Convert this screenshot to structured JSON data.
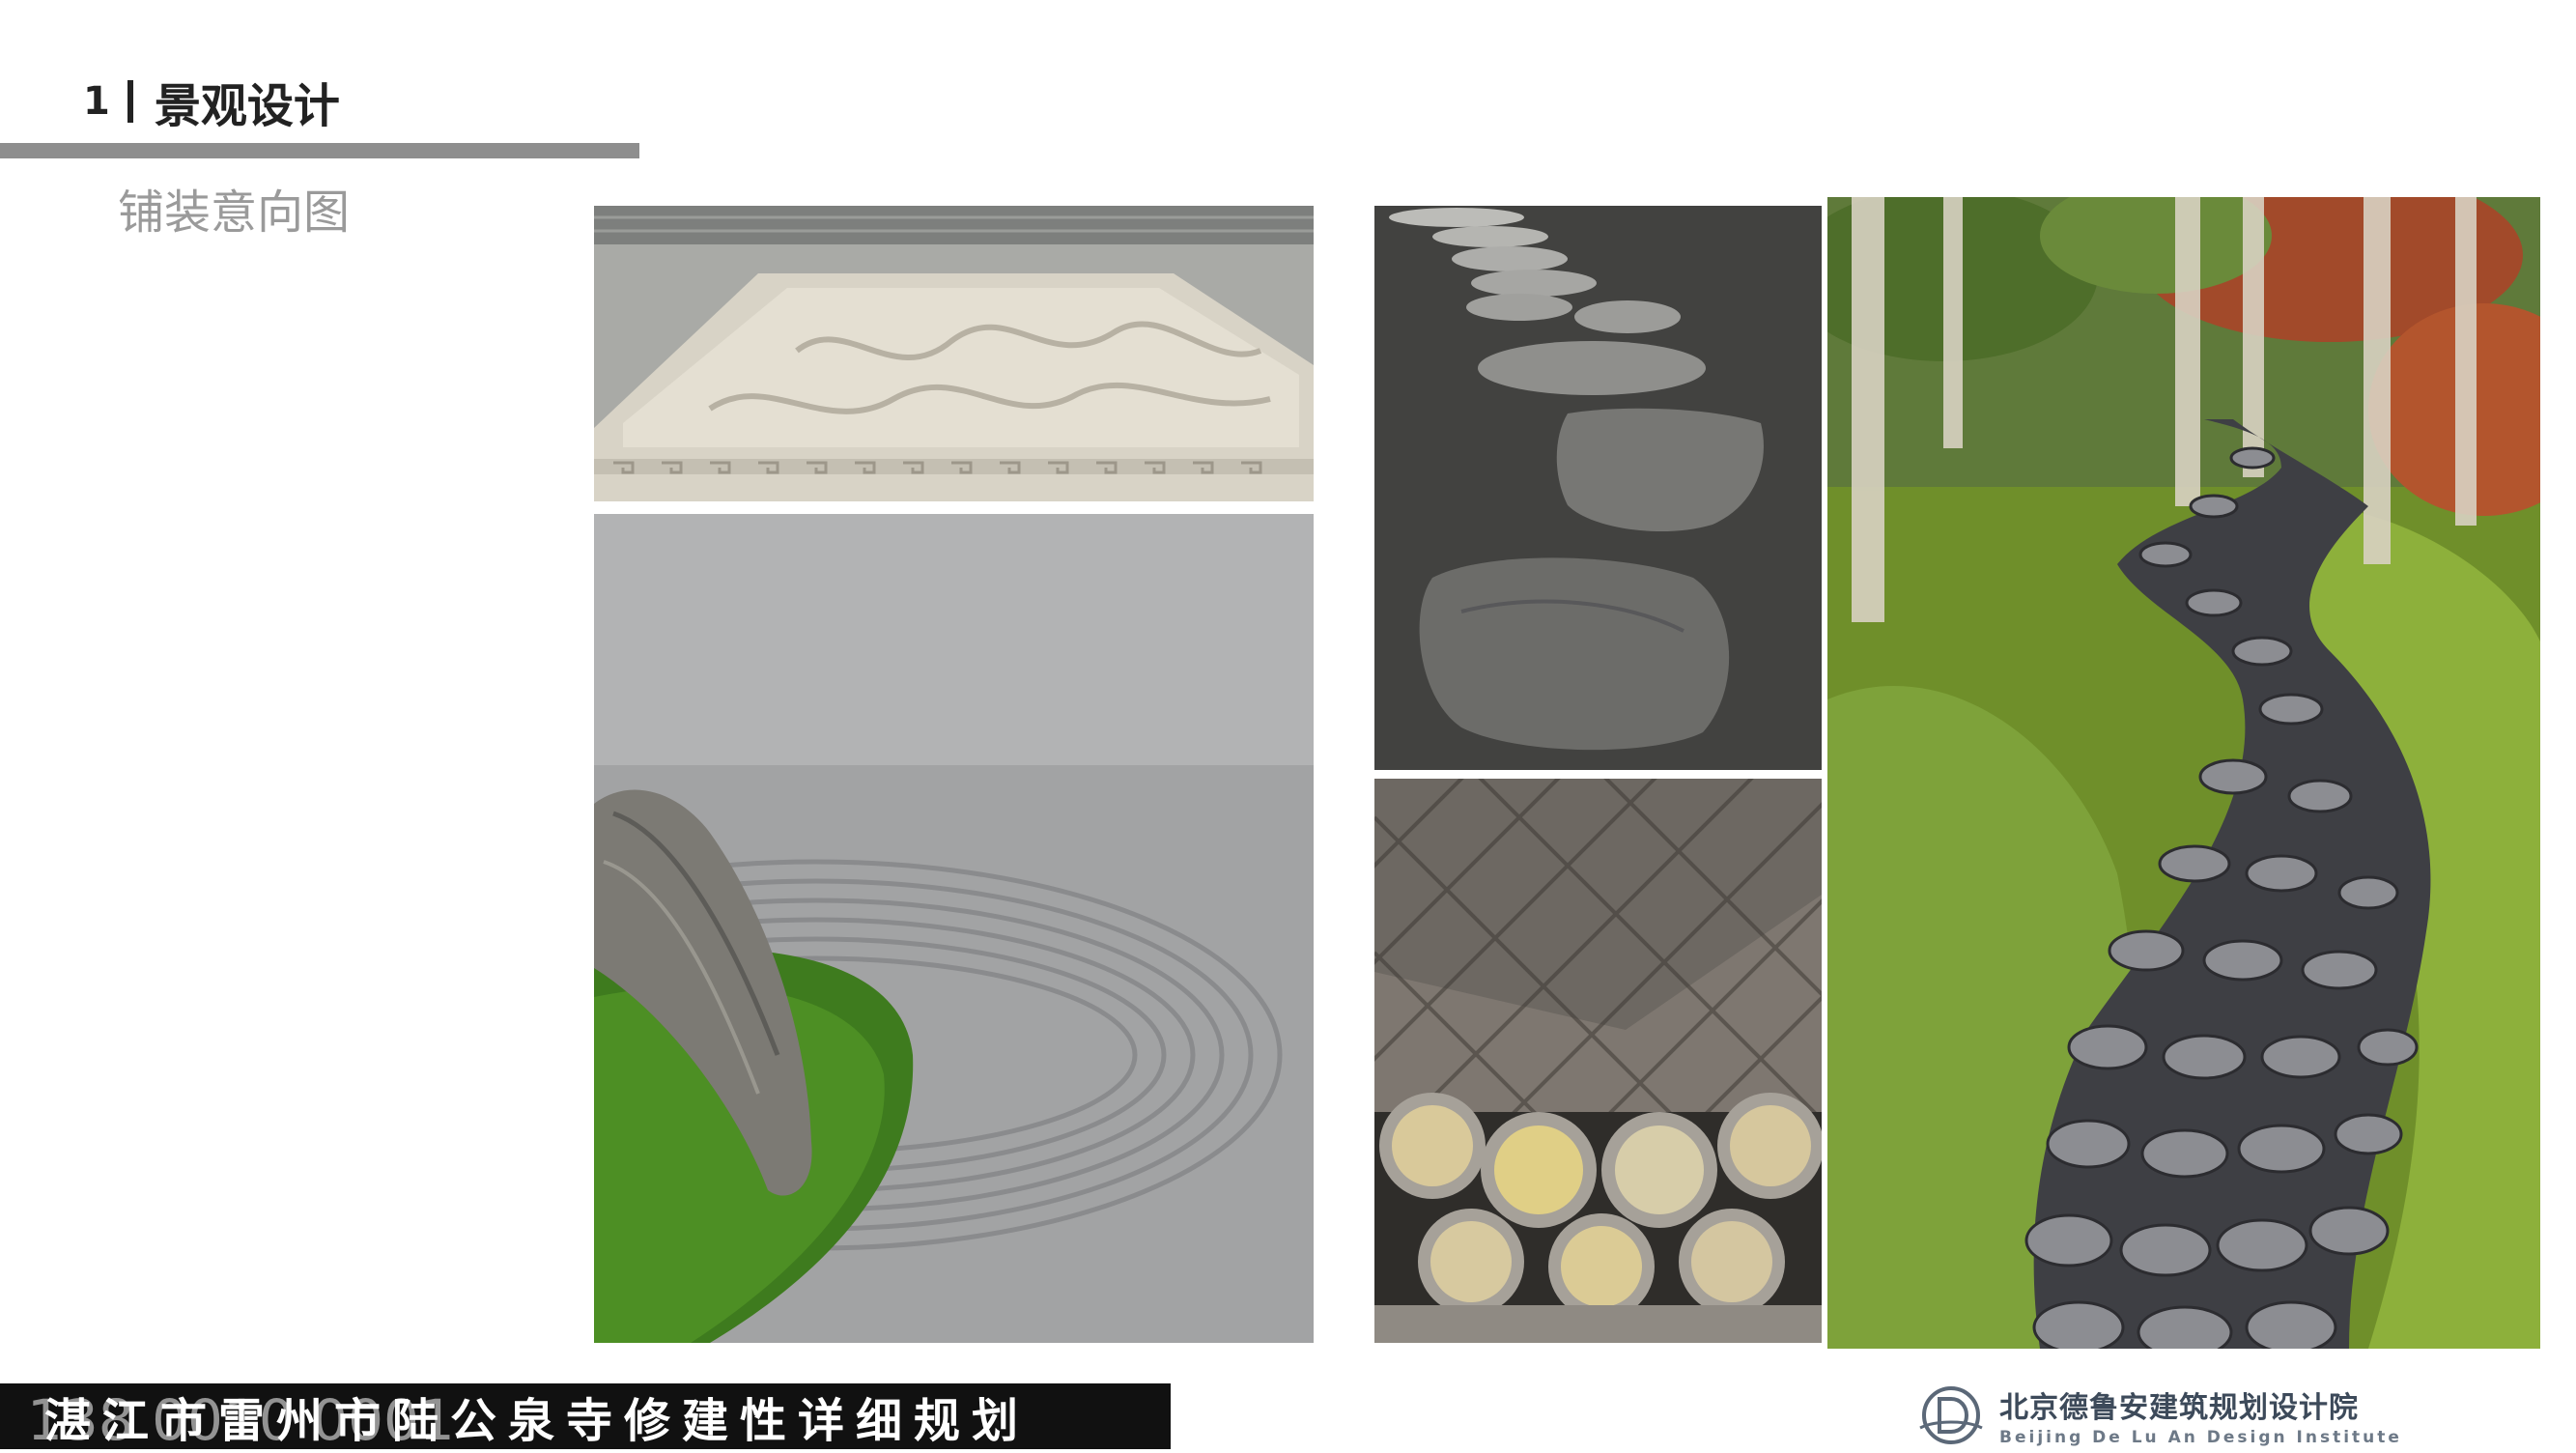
{
  "header": {
    "section_number": "1",
    "section_name": "景观设计",
    "subtitle": "铺装意向图"
  },
  "footer": {
    "project_title": "湛江市雷州市陆公泉寺修建性详细规划",
    "watermark": "138 0010 0001",
    "org_name_cn": "北京德鲁安建筑规划设计院",
    "org_name_en": "Beijing De Lu An Design Institute"
  },
  "photos": [
    {
      "name": "carved-stone-paving-photo"
    },
    {
      "name": "zen-gravel-garden-photo"
    },
    {
      "name": "stepping-stones-photo"
    },
    {
      "name": "herringbone-brick-paving-photo"
    },
    {
      "name": "cobblestone-path-photo"
    }
  ]
}
